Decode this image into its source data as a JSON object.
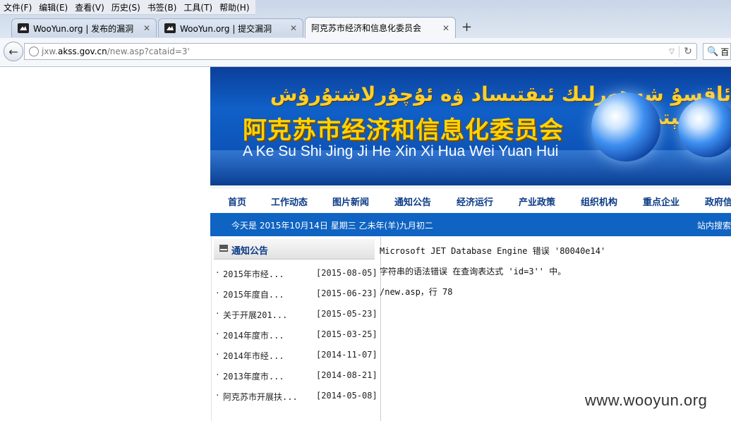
{
  "menubar": [
    "文件(F)",
    "编辑(E)",
    "查看(V)",
    "历史(S)",
    "书签(B)",
    "工具(T)",
    "帮助(H)"
  ],
  "tabs": [
    {
      "title": "WooYun.org | 发布的漏洞"
    },
    {
      "title": "WooYun.org | 提交漏洞"
    },
    {
      "title": "阿克苏市经济和信息化委员会"
    }
  ],
  "new_tab": "+",
  "address": {
    "prefix": "jxw.",
    "domain": "akss.gov.cn",
    "path": "/new.asp?cataid=3'"
  },
  "search": {
    "placeholder": "百"
  },
  "banner": {
    "uyghur": "ئاقسۇ شەھەرلىك ئىقتىساد ۋە ئۇچۇرلاشتۇرۇش كومىتېتى",
    "chinese": "阿克苏市经济和信息化委员会",
    "pinyin": "A Ke Su Shi Jing Ji He Xin Xi Hua Wei Yuan Hui"
  },
  "nav": [
    "首页",
    "工作动态",
    "图片新闻",
    "通知公告",
    "经济运行",
    "产业政策",
    "组织机构",
    "重点企业",
    "政府信"
  ],
  "datebar": {
    "date": "今天是 2015年10月14日 星期三 乙未年(羊)九月初二",
    "site_search": "站内搜索"
  },
  "panel": {
    "title": "通知公告",
    "items": [
      {
        "title": "2015年市经...",
        "date": "[2015-08-05]"
      },
      {
        "title": "2015年度自...",
        "date": "[2015-06-23]"
      },
      {
        "title": "关于开展201...",
        "date": "[2015-05-23]"
      },
      {
        "title": "2014年度市...",
        "date": "[2015-03-25]"
      },
      {
        "title": "2014年市经...",
        "date": "[2014-11-07]"
      },
      {
        "title": "2013年度市...",
        "date": "[2014-08-21]"
      },
      {
        "title": "阿克苏市开展扶...",
        "date": "[2014-05-08]"
      }
    ]
  },
  "error": [
    "Microsoft JET Database Engine 错误 '80040e14'",
    "字符串的语法错误 在查询表达式 'id=3'' 中。",
    "/new.asp，行 78"
  ],
  "watermark": "www.wooyun.org"
}
